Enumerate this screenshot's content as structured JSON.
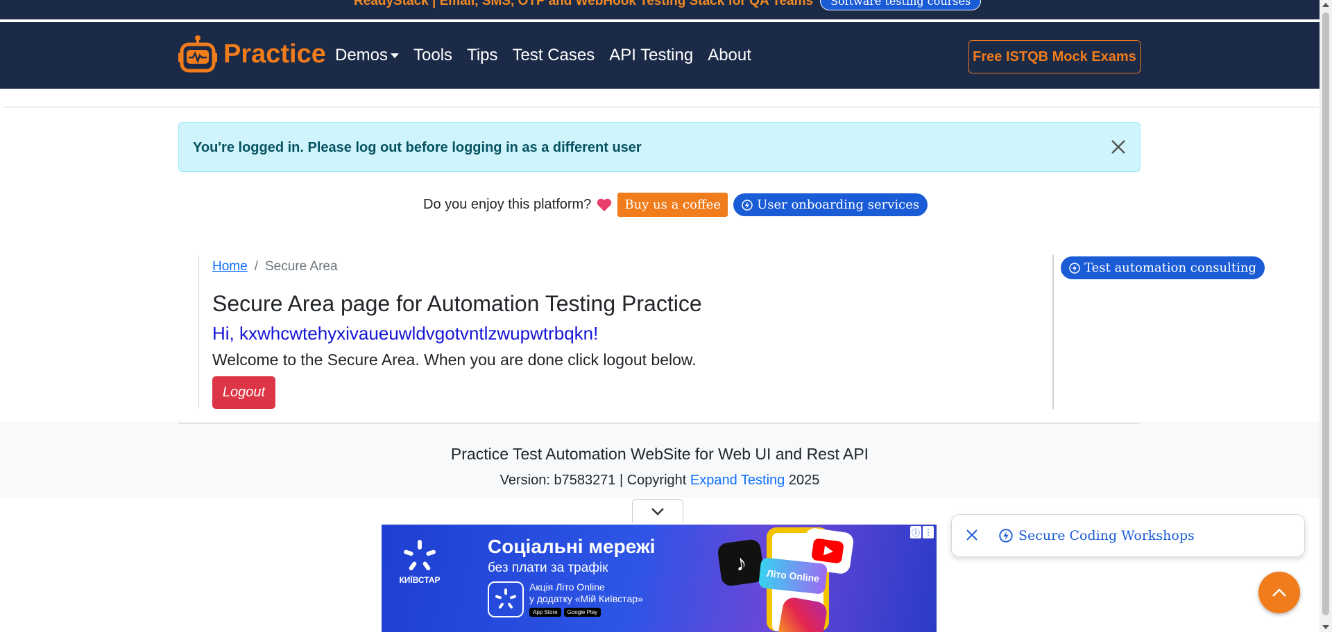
{
  "topbar": {
    "promo_text": "ReadyStack | Email, SMS, OTP and WebHook Testing Stack for QA Teams",
    "promo_button": "Software testing courses"
  },
  "navbar": {
    "brand": "Practice",
    "links": [
      {
        "label": "Demos"
      },
      {
        "label": "Tools"
      },
      {
        "label": "Tips"
      },
      {
        "label": "Test Cases"
      },
      {
        "label": "API Testing"
      },
      {
        "label": "About"
      }
    ],
    "cta": "Free ISTQB Mock Exams"
  },
  "alert": {
    "message": "You're logged in. Please log out before logging in as a different user"
  },
  "support": {
    "question": "Do you enjoy this platform?",
    "coffee_button": "Buy us a coffee",
    "onboarding_button": "User onboarding services"
  },
  "breadcrumb": {
    "home": "Home",
    "separator": "/",
    "current": "Secure Area"
  },
  "main": {
    "title": "Secure Area page for Automation Testing Practice",
    "greeting": "Hi, kxwhcwtehyxivaueuwldvgotvntlzwupwtrbqkn!",
    "welcome": "Welcome to the Secure Area. When you are done click logout below.",
    "logout_button": "Logout"
  },
  "sidebar": {
    "consulting_button": "Test automation consulting"
  },
  "footer": {
    "title": "Practice Test Automation WebSite for Web UI and Rest API",
    "version_prefix": "Version: b7583271 | Copyright ",
    "company": "Expand Testing",
    "year": " 2025"
  },
  "ad": {
    "brand": "КИЇВСТАР",
    "headline": "Соціальні мережі",
    "subline": "без плати за трафік",
    "promo_line1": "Акція Літо Online",
    "promo_line2": "у додатку «Мій Київстар»",
    "store1": "App Store",
    "store2": "Google Play",
    "sticker": "Літо Online"
  },
  "toast": {
    "link": "Secure Coding Workshops"
  },
  "colors": {
    "nav_bg": "#1b2a47",
    "brand_orange": "#f07c1c",
    "link_blue": "#0d6efd",
    "pill_blue": "#1a5bd6",
    "alert_bg": "#cff4fc",
    "danger": "#dc3545"
  }
}
